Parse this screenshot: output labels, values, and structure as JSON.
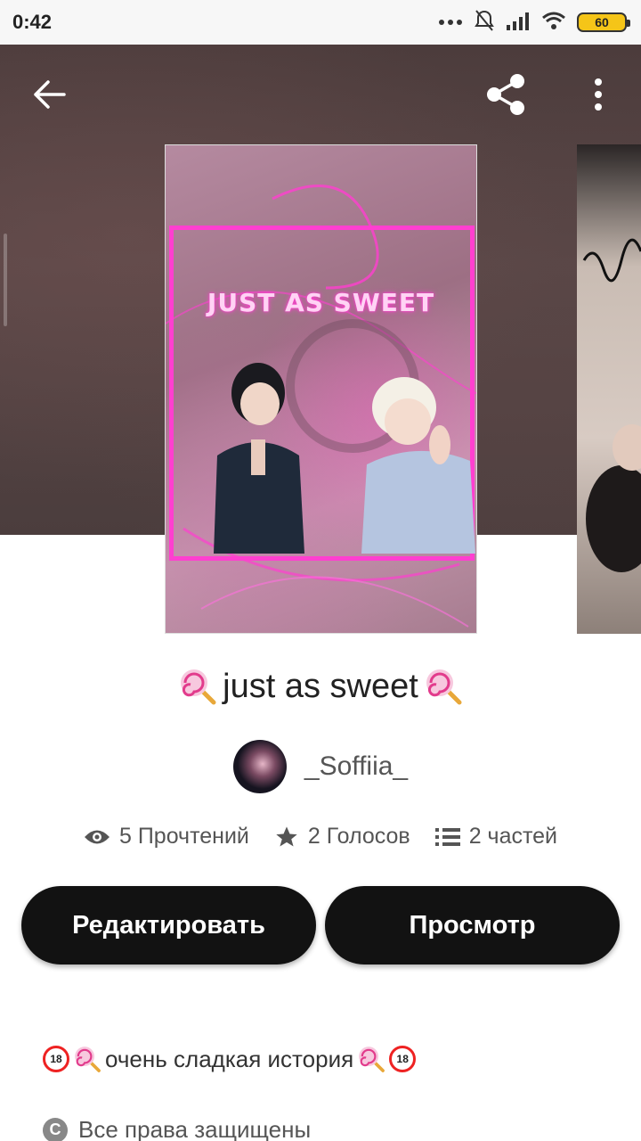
{
  "status_bar": {
    "time": "0:42",
    "battery": "60"
  },
  "cover": {
    "title_text": "JUST AS SWEET"
  },
  "story": {
    "title": "just as sweet",
    "author": "_Soffiia_"
  },
  "stats": {
    "reads": "5 Прочтений",
    "votes": "2 Голосов",
    "parts": "2 частей"
  },
  "actions": {
    "edit_label": "Редактировать",
    "view_label": "Просмотр"
  },
  "description": {
    "text": "очень сладкая история",
    "badge": "18"
  },
  "copyright": {
    "text": "Все права защищены",
    "symbol": "C"
  },
  "colors": {
    "accent_pink": "#ff3fd0",
    "button_bg": "#121212",
    "battery": "#f5c518"
  }
}
